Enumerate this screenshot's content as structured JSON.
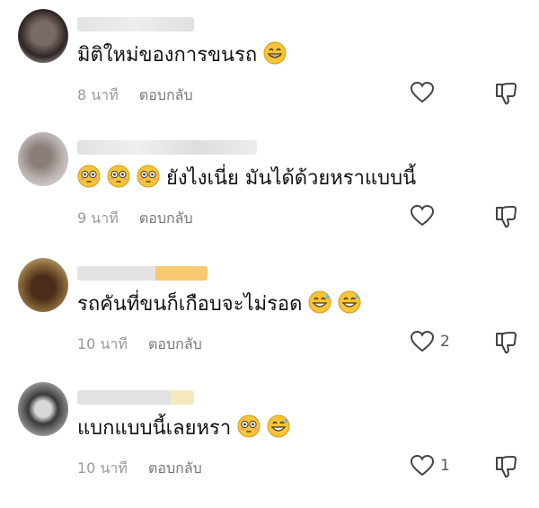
{
  "comments": [
    {
      "text": "มิติใหม่ของการขนรถ",
      "emojis": [
        "grin"
      ],
      "time": "8 นาที",
      "reply_label": "ตอบกลับ",
      "likes": "",
      "avatar_tone": "#4a3b36"
    },
    {
      "text": "ยังไงเนี่ย มันได้ด้วยหราแบบนี้",
      "emojis_before": [
        "flushed",
        "flushed",
        "flushed"
      ],
      "time": "9 นาที",
      "reply_label": "ตอบกลับ",
      "likes": "",
      "avatar_tone": "#9a8f8b"
    },
    {
      "text": "รถคันที่ขนก็เกือบจะไม่รอด",
      "emojis": [
        "sweat-grin",
        "sweat-grin"
      ],
      "time": "10 นาที",
      "reply_label": "ตอบกลับ",
      "likes": "2",
      "avatar_tone": "#6b4b2a"
    },
    {
      "text": "แบกแบบนี้เลยหรา",
      "emojis": [
        "flushed",
        "sweat-grin"
      ],
      "time": "10 นาที",
      "reply_label": "ตอบกลับ",
      "likes": "1",
      "avatar_tone": "#555555"
    }
  ],
  "colors": {
    "text": "#111111",
    "meta": "#999999",
    "emoji_face": "#f7c437"
  }
}
